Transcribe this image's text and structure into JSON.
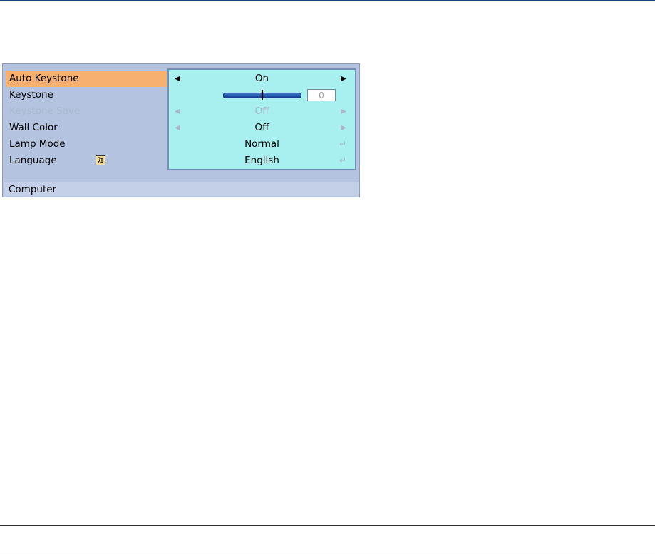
{
  "menu": {
    "items": [
      {
        "label": "Auto Keystone",
        "state": "selected"
      },
      {
        "label": "Keystone",
        "state": "normal"
      },
      {
        "label": "Keystone Save",
        "state": "disabled"
      },
      {
        "label": "Wall Color",
        "state": "normal"
      },
      {
        "label": "Lamp Mode",
        "state": "normal"
      },
      {
        "label": "Language",
        "state": "normal",
        "icon": "language-icon"
      }
    ]
  },
  "values": {
    "auto_keystone": {
      "value": "On",
      "left_arrow": "◀",
      "right_arrow": "▶"
    },
    "keystone": {
      "slider_fraction": 0.5,
      "value": "0"
    },
    "keystone_save": {
      "value": "Off",
      "left_arrow": "◀",
      "right_arrow": "▶"
    },
    "wall_color": {
      "value": "Off",
      "left_arrow": "◀",
      "right_arrow": "▶"
    },
    "lamp_mode": {
      "value": "Normal",
      "enter_glyph": "↵"
    },
    "language": {
      "value": "English",
      "enter_glyph": "↵"
    }
  },
  "status_bar": {
    "label": "Computer"
  },
  "colors": {
    "selected_item": "#f8b070",
    "panel_background": "#b4c4e0",
    "value_panel": "#a8f0f0",
    "disabled_text": "#a8b8d0",
    "top_rule": "#1f3f8f"
  }
}
